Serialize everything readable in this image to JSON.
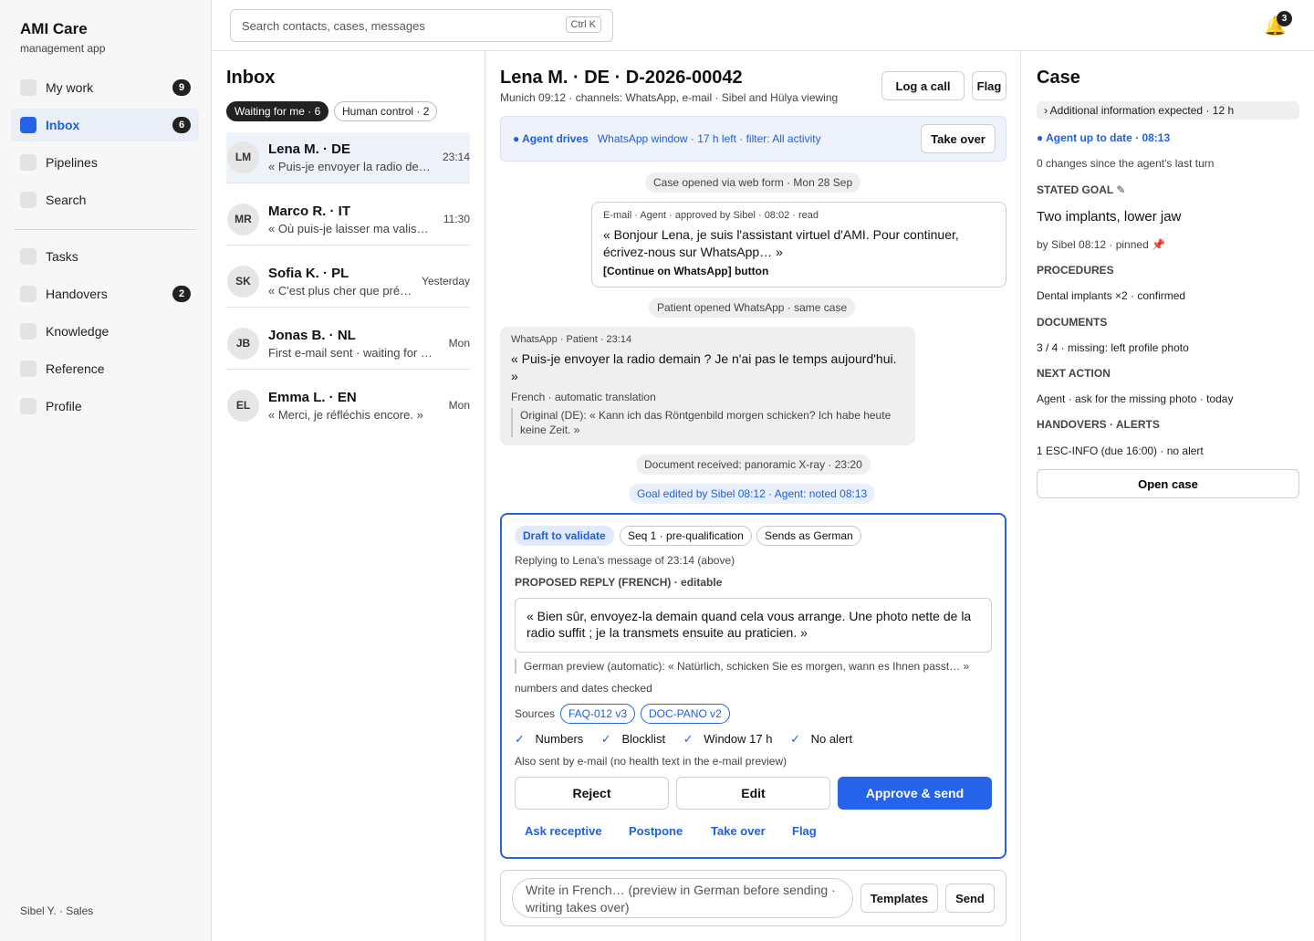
{
  "app": {
    "name": "AMI Care",
    "subtitle": "management app",
    "user": "Sibel Y. · Sales"
  },
  "nav": {
    "primary": [
      {
        "label": "My work",
        "badge": "9"
      },
      {
        "label": "Inbox",
        "badge": "6",
        "active": true
      },
      {
        "label": "Pipelines"
      },
      {
        "label": "Search"
      }
    ],
    "secondary": [
      {
        "label": "Tasks"
      },
      {
        "label": "Handovers",
        "badge": "2"
      },
      {
        "label": "Knowledge"
      },
      {
        "label": "Reference"
      },
      {
        "label": "Profile"
      }
    ]
  },
  "topbar": {
    "search_placeholder": "Search contacts, cases, messages",
    "shortcut": "Ctrl K",
    "notifications": "3"
  },
  "inbox": {
    "title": "Inbox",
    "filters": [
      {
        "label": "Waiting for me · 6",
        "selected": true
      },
      {
        "label": "Human control · 2"
      }
    ],
    "conversations": [
      {
        "initials": "LM",
        "name": "Lena M. · DE",
        "preview": "« Puis-je envoyer la radio demain ? »",
        "time": "23:14",
        "active": true
      },
      {
        "initials": "MR",
        "name": "Marco R. · IT",
        "preview": "« Où puis-je laisser ma valise ? »",
        "time": "11:30"
      },
      {
        "initials": "SK",
        "name": "Sofia K. · PL",
        "preview": "« C'est plus cher que prévu. »",
        "time": "Yesterday"
      },
      {
        "initials": "JB",
        "name": "Jonas B. · NL",
        "preview": "First e-mail sent · waiting for reply",
        "time": "Mon"
      },
      {
        "initials": "EL",
        "name": "Emma L. · EN",
        "preview": "« Merci, je réfléchis encore. »",
        "time": "Mon"
      }
    ]
  },
  "conversation": {
    "title": "Lena M. · DE · D-2026-00042",
    "subtitle": "Munich 09:12 · channels: WhatsApp, e-mail · Sibel and Hülya viewing",
    "log_call": "Log a call",
    "flag": "Flag",
    "agent_bar": {
      "status": "● Agent drives",
      "details": "WhatsApp window · 17 h left · filter: All activity",
      "take_over": "Take over"
    },
    "events": {
      "opened": "Case opened via web form · Mon 28 Sep",
      "whatsapp": "Patient opened WhatsApp · same case",
      "document": "Document received: panoramic X-ray · 23:20",
      "goal": "Goal edited by Sibel 08:12 · Agent: noted 08:13"
    },
    "email_msg": {
      "meta": "E-mail · Agent · approved by Sibel · 08:02 · read",
      "body": "« Bonjour Lena, je suis l'assistant virtuel d'AMI. Pour continuer, écrivez-nous sur WhatsApp… »",
      "button": "[Continue on WhatsApp] button"
    },
    "whatsapp_msg": {
      "meta": "WhatsApp · Patient · 23:14",
      "body": "« Puis-je envoyer la radio demain ? Je n'ai pas le temps aujourd'hui. »",
      "note": "French · automatic translation",
      "original": "Original (DE): « Kann ich das Röntgenbild morgen schicken? Ich habe heute keine Zeit. »"
    },
    "draft": {
      "chips": [
        "Draft to validate",
        "Seq 1 · pre-qualification",
        "Sends as German"
      ],
      "replying": "Replying to Lena's message of 23:14 (above)",
      "label": "PROPOSED REPLY (FRENCH) · editable",
      "reply": "« Bien sûr, envoyez-la demain quand cela vous arrange. Une photo nette de la radio suffit ; je la transmets ensuite au praticien. »",
      "preview": "German preview (automatic): « Natürlich, schicken Sie es morgen, wann es Ihnen passt… »",
      "checked": "numbers and dates checked",
      "sources_label": "Sources",
      "sources": [
        "FAQ-012 v3",
        "DOC-PANO v2"
      ],
      "checks": [
        "Numbers",
        "Blocklist",
        "Window 17 h",
        "No alert"
      ],
      "check_mark": "✓",
      "email_note": "Also sent by e-mail (no health text in the e-mail preview)",
      "reject": "Reject",
      "edit": "Edit",
      "approve": "Approve & send",
      "links": [
        "Ask receptive",
        "Postpone",
        "Take over",
        "Flag"
      ]
    },
    "composer": {
      "placeholder": "Write in French… (preview in German before sending · writing takes over)",
      "templates": "Templates",
      "send": "Send"
    }
  },
  "case": {
    "title": "Case",
    "status_pill": "› Additional information expected · 12 h",
    "agent_status": "● Agent up to date · 08:13",
    "changes": "0 changes since the agent's last turn",
    "stated_goal_label": "STATED GOAL ✎",
    "stated_goal": "Two implants, lower jaw",
    "goal_meta": "by Sibel 08:12 · pinned 📌",
    "procedures_label": "PROCEDURES",
    "procedures": "Dental implants ×2 · confirmed",
    "documents_label": "DOCUMENTS",
    "documents": "3 / 4 · missing: left profile photo",
    "next_action_label": "NEXT ACTION",
    "next_action": "Agent · ask for the missing photo · today",
    "handovers_label": "HANDOVERS · ALERTS",
    "handovers": "1 ESC-INFO (due 16:00) · no alert",
    "open_case": "Open case"
  },
  "colors": {
    "accent": "#2563eb",
    "accent_text": "#1f5fe0",
    "bell": "#e3a11b"
  }
}
